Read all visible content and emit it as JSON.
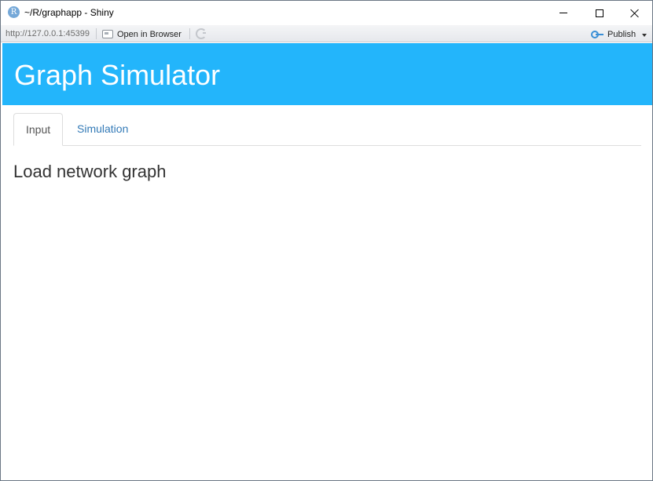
{
  "window": {
    "title": "~/R/graphapp - Shiny",
    "app_icon_letter": "R",
    "controls": {
      "minimize": "minimize-icon",
      "maximize": "maximize-icon",
      "close": "close-icon"
    }
  },
  "toolbar": {
    "url": "http://127.0.0.1:45399",
    "open_in_browser_label": "Open in Browser",
    "publish_label": "Publish"
  },
  "app": {
    "title": "Graph Simulator",
    "header_color": "#23b5fb",
    "tabs": [
      {
        "label": "Input",
        "active": true
      },
      {
        "label": "Simulation",
        "active": false
      }
    ],
    "section_heading": "Load network graph"
  }
}
